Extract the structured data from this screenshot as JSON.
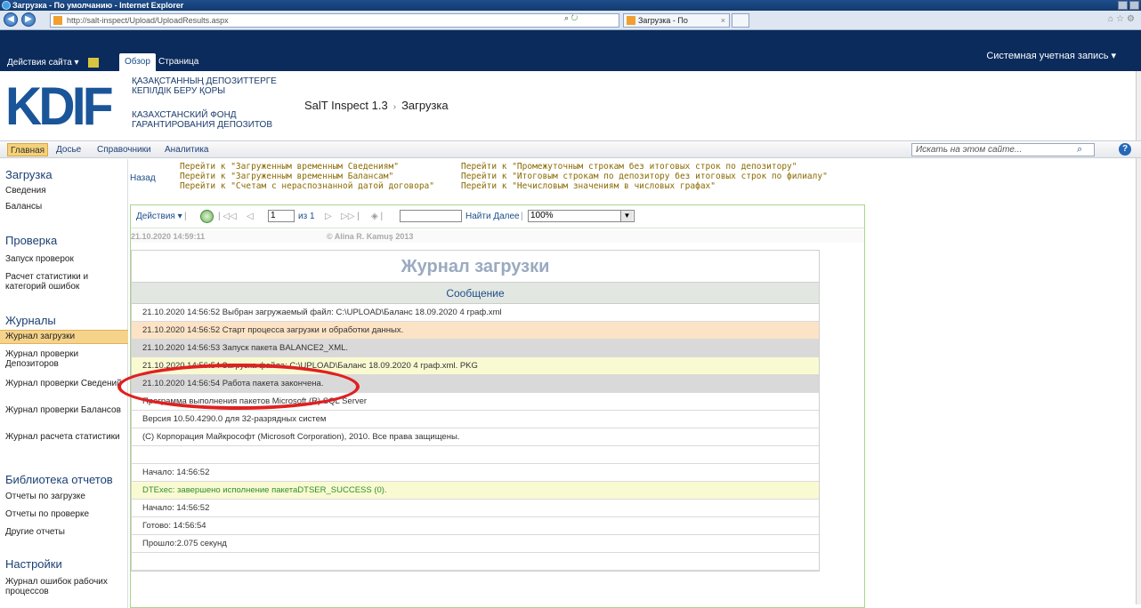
{
  "browser": {
    "title": "Загрузка - По умолчанию - Internet Explorer",
    "url": "http://salt-inspect/Upload/UploadResults.aspx",
    "tab_label": "Загрузка - По умолчанию",
    "tab_close": "×",
    "search_symbol": "⌕"
  },
  "ribbon": {
    "site_actions": "Действия сайта ▾",
    "tab_browse": "Обзор",
    "tab_page": "Страница",
    "account": "Системная учетная запись ▾"
  },
  "header": {
    "logo": "KDIF",
    "org_kz": "ҚАЗАҚСТАННЫҢ ДЕПОЗИТТЕРГЕ КЕПІЛДІК БЕРУ ҚОРЫ",
    "org_ru": "КАЗАХСТАНСКИЙ ФОНД ГАРАНТИРОВАНИЯ ДЕПОЗИТОВ",
    "crumb_site": "SalT Inspect 1.3",
    "crumb_sep": "›",
    "crumb_page": "Загрузка"
  },
  "topnav": {
    "items": [
      "Главная",
      "Досье",
      "Справочники",
      "Аналитика"
    ],
    "search_placeholder": "Искать на этом сайте...",
    "help": "?"
  },
  "leftnav": {
    "groups": [
      {
        "title": "Загрузка",
        "items": [
          "Сведения",
          "Балансы"
        ]
      },
      {
        "title": "Проверка",
        "items": [
          "Запуск проверок",
          "Расчет статистики и категорий ошибок"
        ]
      },
      {
        "title": "Журналы",
        "items": [
          "Журнал загрузки",
          "Журнал проверки Депозиторов",
          "Журнал проверки Сведений",
          "Журнал проверки Балансов",
          "Журнал расчета статистики"
        ]
      },
      {
        "title": "Библиотека отчетов",
        "items": [
          "Отчеты по загрузке",
          "Отчеты по проверке",
          "Другие отчеты"
        ]
      },
      {
        "title": "Настройки",
        "items": [
          "Журнал ошибок рабочих процессов"
        ]
      }
    ],
    "selected": "Журнал загрузки"
  },
  "content": {
    "back": "Назад",
    "links_left": [
      "Перейти к \"Загруженным временным Сведениям\"",
      "Перейти к \"Загруженным временным Балансам\"",
      "Перейти к \"Счетам с нераспознанной датой договора\""
    ],
    "links_right": [
      "Перейти к \"Промежуточным строкам без итоговых строк по депозитору\"",
      "Перейти к \"Итоговым строкам по депозитору без итоговых строк по филиалу\"",
      "Перейти к \"Нечисловым значениям в числовых графах\""
    ]
  },
  "toolbar": {
    "actions": "Действия ▾",
    "page": "1",
    "of": "из 1",
    "find_next": "Найти Далее",
    "zoom": "100%"
  },
  "report": {
    "timestamp": "21.10.2020 14:59:11",
    "copyright": "© Alina R. Kamuş 2013",
    "title": "Журнал загрузки",
    "column": "Сообщение",
    "rows": [
      {
        "text": "21.10.2020 14:56:52 Выбран загружаемый файл: C:\\UPLOAD\\Баланс 18.09.2020 4 граф.xml",
        "style": ""
      },
      {
        "text": "21.10.2020 14:56:52 Старт процесса загрузки и обработки данных.",
        "style": "orange"
      },
      {
        "text": "21.10.2020 14:56:53 Запуск пакета BALANCE2_XML.",
        "style": "gray"
      },
      {
        "text": "21.10.2020 14:56:54 Загрузка файла: C:\\UPLOAD\\Баланс 18.09.2020 4 граф.xml. PKG",
        "style": "yellow"
      },
      {
        "text": "21.10.2020 14:56:54 Работа пакета закончена.",
        "style": "gray"
      },
      {
        "text": "Программа выполнения пакетов Microsoft (R) SQL Server",
        "style": ""
      },
      {
        "text": "Версия 10.50.4290.0 для 32-разрядных систем",
        "style": ""
      },
      {
        "text": "(C) Корпорация Майкрософт (Microsoft Corporation), 2010. Все права защищены.",
        "style": ""
      },
      {
        "text": "",
        "style": "empty"
      },
      {
        "text": "Начало: 14:56:52",
        "style": ""
      },
      {
        "text": "DTExec: завершено исполнение пакетаDTSER_SUCCESS (0).",
        "style": "yellow green"
      },
      {
        "text": "Начало: 14:56:52",
        "style": ""
      },
      {
        "text": "Готово: 14:56:54",
        "style": ""
      },
      {
        "text": "Прошло:2.075 секунд",
        "style": ""
      },
      {
        "text": "",
        "style": "empty"
      }
    ]
  }
}
